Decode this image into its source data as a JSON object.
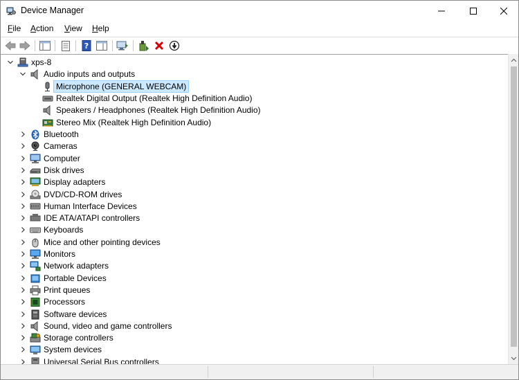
{
  "window": {
    "title": "Device Manager"
  },
  "menu": {
    "file": {
      "pre": "",
      "u": "F",
      "post": "ile"
    },
    "action": {
      "pre": "",
      "u": "A",
      "post": "ction"
    },
    "view": {
      "pre": "",
      "u": "V",
      "post": "iew"
    },
    "help": {
      "pre": "",
      "u": "H",
      "post": "elp"
    }
  },
  "tree": {
    "root": "xps-8",
    "audio": {
      "label": "Audio inputs and outputs",
      "children": [
        "Microphone (GENERAL WEBCAM)",
        "Realtek Digital Output (Realtek High Definition Audio)",
        "Speakers / Headphones (Realtek High Definition Audio)",
        "Stereo Mix (Realtek High Definition Audio)"
      ]
    },
    "categories": [
      {
        "label": "Bluetooth",
        "icon": "bluetooth-icon"
      },
      {
        "label": "Cameras",
        "icon": "camera-icon"
      },
      {
        "label": "Computer",
        "icon": "computer-icon"
      },
      {
        "label": "Disk drives",
        "icon": "disk-drive-icon"
      },
      {
        "label": "Display adapters",
        "icon": "display-adapter-icon"
      },
      {
        "label": "DVD/CD-ROM drives",
        "icon": "dvd-drive-icon"
      },
      {
        "label": "Human Interface Devices",
        "icon": "hid-icon"
      },
      {
        "label": "IDE ATA/ATAPI controllers",
        "icon": "ide-controller-icon"
      },
      {
        "label": "Keyboards",
        "icon": "keyboard-icon"
      },
      {
        "label": "Mice and other pointing devices",
        "icon": "mouse-icon"
      },
      {
        "label": "Monitors",
        "icon": "monitor-icon"
      },
      {
        "label": "Network adapters",
        "icon": "network-adapter-icon"
      },
      {
        "label": "Portable Devices",
        "icon": "portable-device-icon"
      },
      {
        "label": "Print queues",
        "icon": "printer-icon"
      },
      {
        "label": "Processors",
        "icon": "processor-icon"
      },
      {
        "label": "Software devices",
        "icon": "software-device-icon"
      },
      {
        "label": "Sound, video and game controllers",
        "icon": "speaker-icon"
      },
      {
        "label": "Storage controllers",
        "icon": "storage-controller-icon"
      },
      {
        "label": "System devices",
        "icon": "system-device-icon"
      },
      {
        "label": "Universal Serial Bus controllers",
        "icon": "usb-icon"
      }
    ]
  },
  "colors": {
    "selection": "#cce8ff",
    "uninstall_red": "#d40000"
  }
}
